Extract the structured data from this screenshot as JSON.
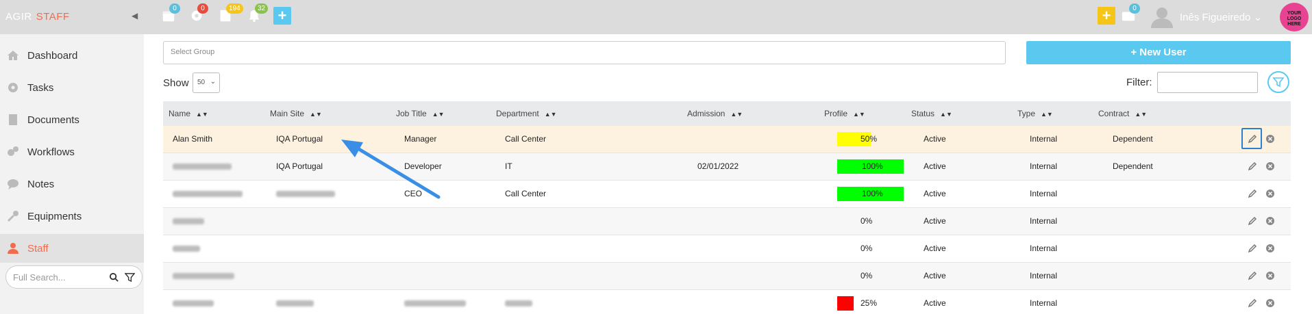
{
  "app": {
    "brand_left": "AGIR",
    "brand_right": "STAFF",
    "collapse_icon": "chevron-left-icon"
  },
  "topbar": {
    "calendar_badge": "0",
    "settings_badge": "0",
    "messages_badge": "194",
    "notifications_badge": "32",
    "inbox_badge": "0",
    "user_name": "Inês Figueiredo",
    "logo_text": "YOUR LOGO HERE",
    "colors": {
      "blue": "#5bc0de",
      "red": "#e74c3c",
      "yellow": "#f5c518",
      "green": "#8bc34a",
      "accent": "#f26b4f"
    }
  },
  "sidebar": {
    "items": [
      {
        "label": "Dashboard",
        "icon": "home-icon"
      },
      {
        "label": "Tasks",
        "icon": "gear-icon"
      },
      {
        "label": "Documents",
        "icon": "document-icon"
      },
      {
        "label": "Workflows",
        "icon": "workflow-icon"
      },
      {
        "label": "Notes",
        "icon": "chat-icon"
      },
      {
        "label": "Equipments",
        "icon": "wrench-icon"
      },
      {
        "label": "Staff",
        "icon": "user-icon"
      }
    ],
    "search_placeholder": "Full Search..."
  },
  "main": {
    "group_placeholder": "Select Group",
    "new_user_label": "+ New User",
    "show_label": "Show",
    "show_value": "50",
    "filter_label": "Filter:"
  },
  "table": {
    "headers": [
      "Name",
      "Main Site",
      "Job Title",
      "Department",
      "Admission",
      "Profile",
      "Status",
      "Type",
      "Contract"
    ],
    "rows": [
      {
        "name": "Alan Smith",
        "site": "IQA Portugal",
        "job": "Manager",
        "dept": "Call Center",
        "admission": "",
        "profile": "50%",
        "profile_value": 0.5,
        "profile_color": "#ffff00",
        "status": "Active",
        "type": "Internal",
        "contract": "Dependent"
      },
      {
        "name": "",
        "site": "IQA Portugal",
        "job": "Developer",
        "dept": "IT",
        "admission": "02/01/2022",
        "profile": "100%",
        "profile_value": 1.0,
        "profile_color": "#00ff00",
        "status": "Active",
        "type": "Internal",
        "contract": "Dependent"
      },
      {
        "name": "",
        "site": "",
        "job": "CEO",
        "dept": "Call Center",
        "admission": "",
        "profile": "100%",
        "profile_value": 1.0,
        "profile_color": "#00ff00",
        "status": "Active",
        "type": "Internal",
        "contract": ""
      },
      {
        "name": "",
        "site": "",
        "job": "",
        "dept": "",
        "admission": "",
        "profile": "0%",
        "profile_value": 0,
        "profile_color": "",
        "status": "Active",
        "type": "Internal",
        "contract": ""
      },
      {
        "name": "",
        "site": "",
        "job": "",
        "dept": "",
        "admission": "",
        "profile": "0%",
        "profile_value": 0,
        "profile_color": "",
        "status": "Active",
        "type": "Internal",
        "contract": ""
      },
      {
        "name": "",
        "site": "",
        "job": "",
        "dept": "",
        "admission": "",
        "profile": "0%",
        "profile_value": 0,
        "profile_color": "",
        "status": "Active",
        "type": "Internal",
        "contract": ""
      },
      {
        "name": "",
        "site": "",
        "job": "",
        "dept": "",
        "admission": "",
        "profile": "25%",
        "profile_value": 0.25,
        "profile_color": "#ff0000",
        "status": "Active",
        "type": "Internal",
        "contract": ""
      }
    ]
  }
}
